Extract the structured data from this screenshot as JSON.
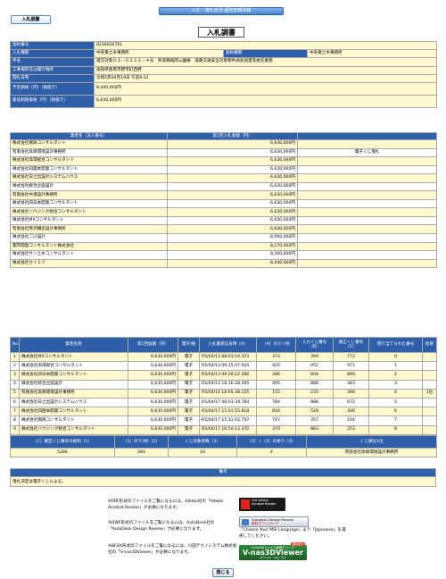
{
  "header": {
    "title": "入札・落札状況-個別詳細情報",
    "tag_button": "入札調書",
    "page_title": "入札調書"
  },
  "info": {
    "contract_no": {
      "label": "契約番号",
      "value": "0230026701"
    },
    "bid_agency": {
      "label": "入札機関",
      "value": "中央東土木事務所"
    },
    "contract_agency": {
      "label": "契約機関",
      "value": "中央東土木事務所"
    },
    "case_name": {
      "label": "件名",
      "value": "道交対第０３－０２２２－４号　県道鵜尾岡公園線　道路交通安全対策物件調査測量等委託業務"
    },
    "location": {
      "label": "工事場所又は履行場所",
      "value": "高知県香南市野市町西野"
    },
    "bid_date": {
      "label": "開札日時",
      "value": "令和5年04月19日 午前9:22"
    },
    "planned_price": {
      "label": "予定価格（円）（税抜き）",
      "value": "8,440,000円"
    },
    "min_price": {
      "label": "最低制限価格（円）（税抜き）",
      "value": "6,630,000円"
    }
  },
  "bids": {
    "headers": [
      "業者名（法人番号）",
      "第1回入札金額（円）",
      ""
    ],
    "rows": [
      {
        "name": "株式会社帽目コンサルタント",
        "amount": "6,630,000円",
        "note": ""
      },
      {
        "name": "有限会社高保環境設計事務所",
        "amount": "6,630,000円",
        "note": "電子くじ落札"
      },
      {
        "name": "株式会社高環総合コンサルタント",
        "amount": "6,630,000円",
        "note": ""
      },
      {
        "name": "株式会社四国本開発コンサルタント",
        "amount": "6,630,000円",
        "note": ""
      },
      {
        "name": "株式会社日之出設計システムハウス",
        "amount": "6,630,000円",
        "note": ""
      },
      {
        "name": "株式会社総合企画設計",
        "amount": "6,630,000円",
        "note": ""
      },
      {
        "name": "有限会社中澤設計事務所",
        "amount": "6,630,000円",
        "note": ""
      },
      {
        "name": "株式会社四日本開発コンサルタント",
        "amount": "6,630,000円",
        "note": ""
      },
      {
        "name": "株式会社ハウジング総合コンサルタント",
        "amount": "6,630,000円",
        "note": ""
      },
      {
        "name": "株式会社MXコンサルタント",
        "amount": "6,630,000円",
        "note": ""
      },
      {
        "name": "有限会社熊沢構造設計事務所",
        "amount": "6,640,000円",
        "note": ""
      },
      {
        "name": "株式会社二川設計",
        "amount": "8,000,000円",
        "note": ""
      },
      {
        "name": "都市開発コンサルタント株式会社",
        "amount": "8,270,000円",
        "note": ""
      },
      {
        "name": "株式会社サン土木コンサルタント",
        "amount": "8,300,000円",
        "note": ""
      },
      {
        "name": "株式会社セイミツ",
        "amount": "8,440,000円",
        "note": ""
      }
    ]
  },
  "lottery": {
    "headers": [
      "No",
      "業者名称",
      "第1回金額（円）",
      "電子/紙",
      "入札書受信日時（A）",
      "（A）のミリ秒",
      "入力くじ番号（B）",
      "補正くじ番号（C）",
      "割り当てられた番号",
      "結果"
    ],
    "rows": [
      {
        "no": "1",
        "name": "株式会社MXコンサルタント",
        "amount": "6,630,000円",
        "type": "電子",
        "time": "R5/04/13 08:01:54.373",
        "ms": "373",
        "b": "399",
        "c": "772",
        "assigned": "0",
        "result": ""
      },
      {
        "no": "2",
        "name": "株式会社高環総合コンサルタント",
        "amount": "6,630,000円",
        "type": "電子",
        "time": "R5/04/13 09:15:47.920",
        "ms": "920",
        "b": "051",
        "c": "971",
        "assigned": "1",
        "result": ""
      },
      {
        "no": "3",
        "name": "株式会社四日本開発コンサルタント",
        "amount": "6,630,000円",
        "type": "電子",
        "time": "R5/04/13 09:26:22.286",
        "ms": "286",
        "b": "604",
        "c": "890",
        "assigned": "2",
        "result": ""
      },
      {
        "no": "4",
        "name": "株式会社総合企画設計",
        "amount": "6,630,000円",
        "type": "電子",
        "time": "R5/04/13 18:16:28.495",
        "ms": "495",
        "b": "888",
        "c": "383",
        "assigned": "3",
        "result": ""
      },
      {
        "no": "5",
        "name": "有限会社高保環境設計事務所",
        "amount": "6,630,000円",
        "type": "電子",
        "time": "R5/04/14 18:05:38.155",
        "ms": "155",
        "b": "235",
        "c": "390",
        "assigned": "4",
        "result": "1位"
      },
      {
        "no": "6",
        "name": "株式会社日之出設計システムハウス",
        "amount": "6,630,000円",
        "type": "電子",
        "time": "R5/04/17 08:03:34.784",
        "ms": "784",
        "b": "888",
        "c": "672",
        "assigned": "5",
        "result": ""
      },
      {
        "no": "7",
        "name": "株式会社四国本開発コンサルタント",
        "amount": "6,630,000円",
        "type": "電子",
        "time": "R5/04/17 15:01:55.818",
        "ms": "818",
        "b": "528",
        "c": "346",
        "assigned": "6",
        "result": ""
      },
      {
        "no": "8",
        "name": "株式会社帽目コンサルタント",
        "amount": "6,630,000円",
        "type": "電子",
        "time": "R5/04/17 15:31:02.747",
        "ms": "747",
        "b": "357",
        "c": "104",
        "assigned": "7",
        "result": ""
      },
      {
        "no": "9",
        "name": "株式会社ハウジング総合コンサルタント",
        "amount": "6,630,000円",
        "type": "電子",
        "time": "R5/04/17 16:54:12.370",
        "ms": "370",
        "b": "883",
        "c": "253",
        "assigned": "8",
        "result": ""
      },
      {
        "no": "10",
        "name": "有限会社中澤設計事務所",
        "amount": "6,630,000円",
        "type": "電子",
        "time": "R5/04/18 14:59:08.615",
        "ms": "615",
        "b": "888",
        "c": "503",
        "assigned": "9",
        "result": ""
      }
    ]
  },
  "summary": {
    "headers": [
      "（C）確定くじ番号の総和（1）",
      "（1）の下3桁（2）",
      "くじ対象者数（3）",
      "（2）÷（3）の余り（4）",
      "くじ順位1位"
    ],
    "values": [
      "5284",
      "284",
      "10",
      "4",
      "有限会社高保環境設計事務所"
    ]
  },
  "remarks": {
    "header": "備考",
    "text": "落札決定は電子くじによる。"
  },
  "notices": {
    "pdf": "※PDF形式のファイルをご覧になるには、Adobe社の「Adobe Acrobat Reader」が必要になります。",
    "dwf": "※DWF形式のファイルをご覧になるには、AutoDesk社の「AutoDesk Design Review」が必要になります。",
    "bfox": "※BFOX形式のファイルをご覧になるには、川田テクノシステム株式会社の「V-nas3DViewer」が必要になります。",
    "mslang": "「Choose Your MSI Language」より「Japanese」を選択してください。"
  },
  "badges": {
    "adobe_line1": "Get Adobe",
    "adobe_line2": "Acrobat Reader",
    "adr_line1": "Autodesk Design Review",
    "adr_line2": "無料ダウンロード",
    "v3d_top": "V-nas3Dファイル無償ビューア",
    "v3d_name": "V-nas3DViewer",
    "v3d_sub": "ダウンロードはこちら",
    "v3d_free": "無料配布"
  },
  "close_button": "閉じる"
}
